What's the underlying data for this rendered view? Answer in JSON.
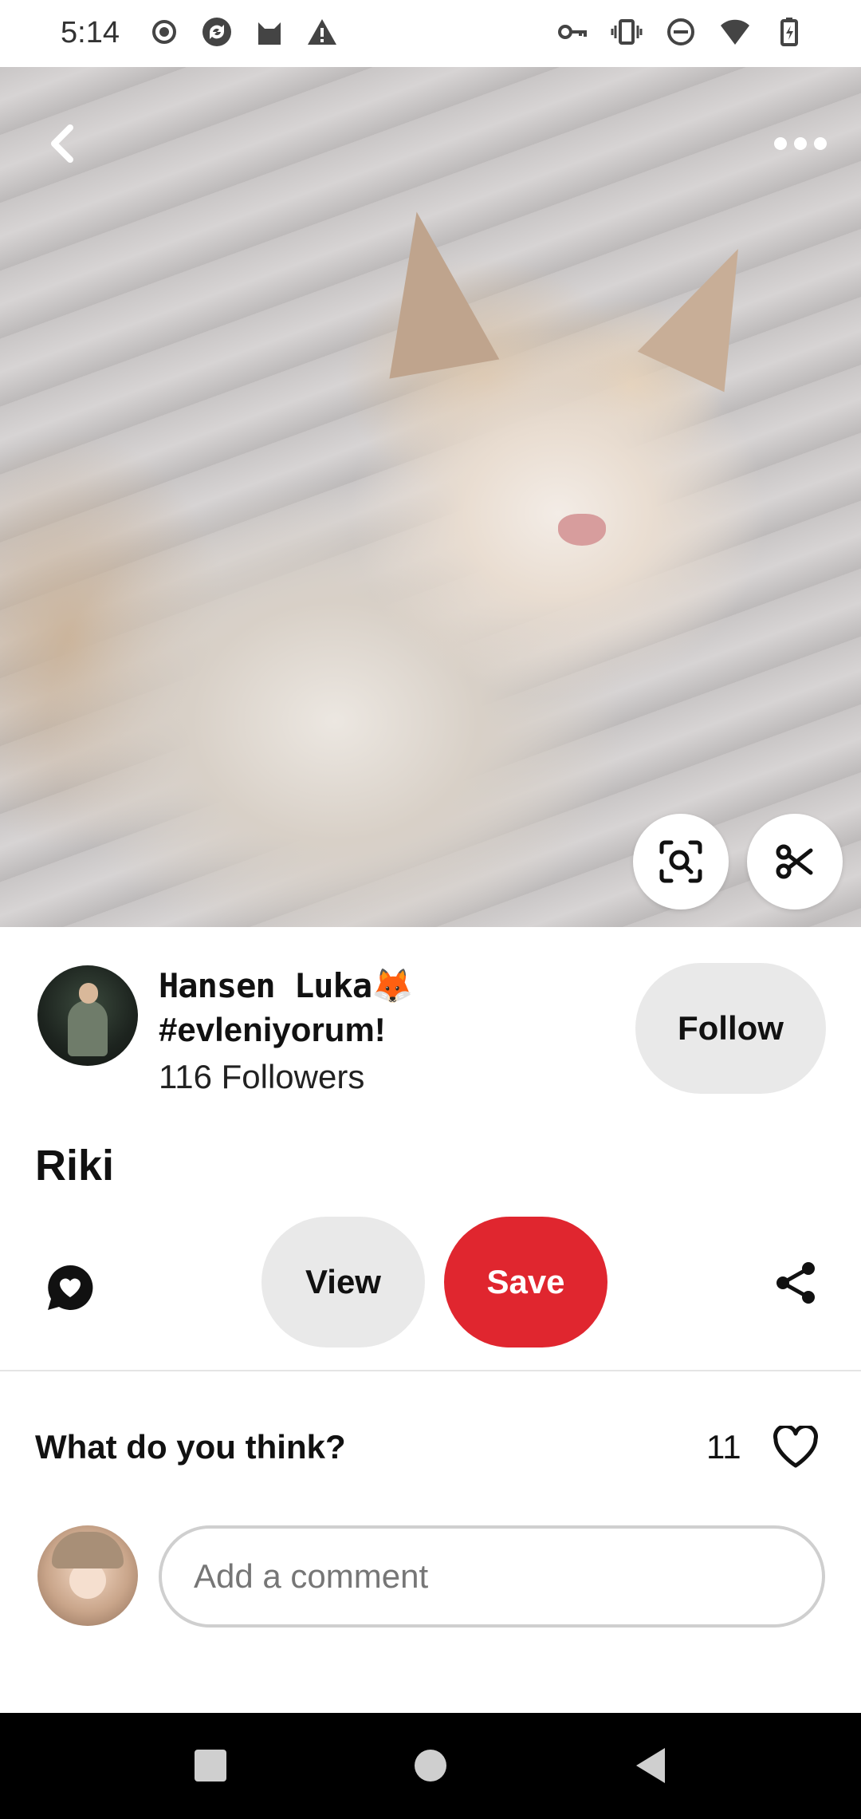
{
  "status_bar": {
    "time": "5:14",
    "left_icons": [
      "record-icon",
      "sync-icon",
      "cat-app-icon",
      "alert-icon"
    ],
    "right_icons": [
      "vpn-key-icon",
      "vibrate-icon",
      "do-not-disturb-icon",
      "wifi-icon",
      "battery-charging-icon"
    ]
  },
  "pin": {
    "image_description": "",
    "title": "Riki"
  },
  "creator": {
    "name": "Hansen Luka🦊",
    "subtitle": "#evleniyorum!",
    "followers": "116 Followers",
    "follow_label": "Follow"
  },
  "actions": {
    "view_label": "View",
    "save_label": "Save"
  },
  "comments": {
    "prompt": "What do you think?",
    "like_count": "11",
    "placeholder": "Add a comment"
  },
  "colors": {
    "save": "#e0262f",
    "secondary_button": "#e9e9e9",
    "nav_bar": "#000000"
  }
}
